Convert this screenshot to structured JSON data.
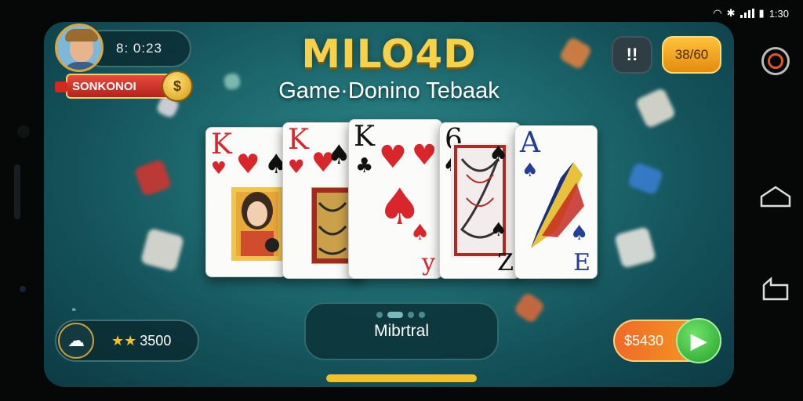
{
  "status_bar": {
    "time": "1:30"
  },
  "player": {
    "timer": "8: 0:23",
    "name": "SONKONOI",
    "coin_symbol": "$"
  },
  "header": {
    "title": "MILO4D",
    "subtitle": "Game·Donino Tebaak"
  },
  "top_right": {
    "icon_label": "!!",
    "coins": "38/60"
  },
  "cards": [
    {
      "rank": "K",
      "suit_a": "♥",
      "suit_b": "♥",
      "suit_c": "♠",
      "rank_color": "red"
    },
    {
      "rank": "K",
      "suit_a": "♥",
      "suit_b": "♥",
      "suit_c": "♠",
      "rank_color": "red"
    },
    {
      "rank": "K",
      "suit_a": "♥",
      "suit_b": "♥",
      "suit_c": "♣",
      "rank_color": "blk",
      "center": "♠",
      "bottom": "y"
    },
    {
      "rank": "6",
      "suit_a": "♠",
      "suit_b": "♠",
      "suit_c": "♠",
      "rank_color": "blk",
      "bottom": "Z"
    },
    {
      "rank": "A",
      "suit_a": "♠",
      "suit_b": "♠",
      "suit_c": "♠",
      "rank_color": "blu",
      "bottom": "E"
    }
  ],
  "bottom": {
    "quote": "“",
    "stars": "★★",
    "score": "3500",
    "mode_label": "Mibrtral",
    "bet": "$5430",
    "go_symbol": "▶"
  },
  "colors": {
    "accent_gold": "#f6d24a",
    "table_green": "#1f6d72",
    "go_green": "#27a129",
    "bet_orange": "#f06a28"
  }
}
